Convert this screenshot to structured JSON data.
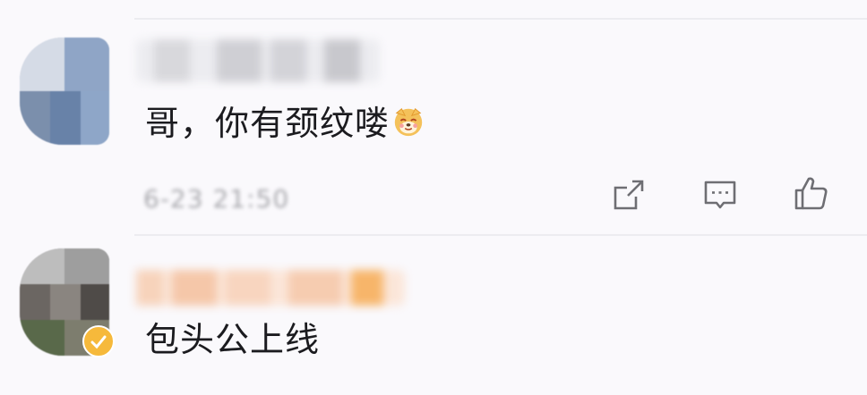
{
  "comments": [
    {
      "text": "哥，你有颈纹喽",
      "emoji": "shiba-dog-emoji",
      "time": "6-23 21:50",
      "actions": [
        "share-icon",
        "reply-icon",
        "like-icon"
      ]
    },
    {
      "text": "包头公上线",
      "badge": "vip-badge"
    }
  ],
  "colors": {
    "background": "#faf9fc",
    "text": "#1b1b1f",
    "secondary": "#a8a8ad",
    "icon": "#6e6e73",
    "divider": "#ececf0",
    "badge": "#f6b93b"
  }
}
